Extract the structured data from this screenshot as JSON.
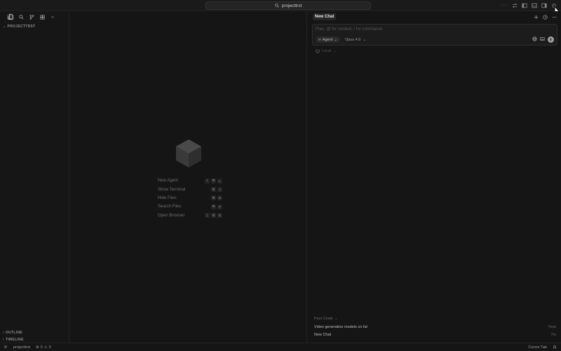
{
  "search": {
    "label": "projecttrst"
  },
  "sidebar": {
    "project_title": "PROJECTTRST",
    "outline_label": "OUTLINE",
    "timeline_label": "TIMELINE"
  },
  "shortcuts": [
    {
      "label": "New Agent",
      "keys": [
        "⇧",
        "⌘",
        "L"
      ]
    },
    {
      "label": "Show Terminal",
      "keys": [
        "⌘",
        "J"
      ]
    },
    {
      "label": "Hide Files",
      "keys": [
        "⌘",
        "B"
      ]
    },
    {
      "label": "Search Files",
      "keys": [
        "⌘",
        "P"
      ]
    },
    {
      "label": "Open Browser",
      "keys": [
        "⇧",
        "⌘",
        "B"
      ]
    }
  ],
  "chat": {
    "tab_label": "New Chat",
    "input_placeholder": "Plan, @ for context, / for commands",
    "agent_label": "Agent",
    "model_label": "Opus 4.6",
    "local_label": "Local",
    "past_title": "Past Chats",
    "past_chats": [
      {
        "title": "Video generation models on fal",
        "time": "Now"
      },
      {
        "title": "New Chat",
        "time": "7m"
      }
    ]
  },
  "status": {
    "branch": "projecttrst",
    "errors": "0",
    "warnings": "0",
    "cursor_tab": "Cursor Tab"
  },
  "colors": {
    "background": "#141414",
    "panel": "#1c1c1c",
    "text": "#cfcfcf"
  }
}
